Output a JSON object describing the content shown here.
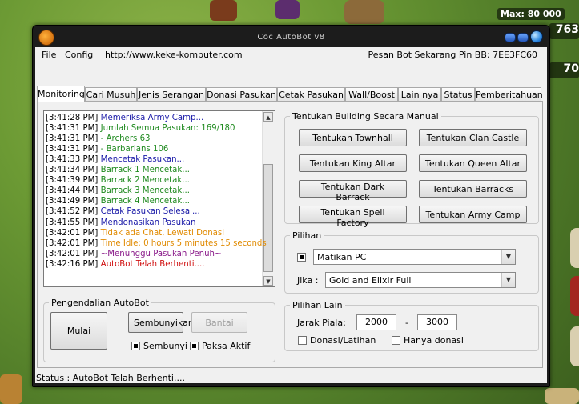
{
  "game_hud": {
    "max_label": "Max: 80 000",
    "value_top": "763",
    "value_side": "70"
  },
  "window": {
    "title": "Coc AutoBot v8",
    "menu": [
      "File",
      "Config",
      "http://www.keke-komputer.com"
    ],
    "pin_text": "Pesan Bot Sekarang Pin BB: 7EE3FC60"
  },
  "tabs": [
    {
      "label": "Monitoring",
      "active": true
    },
    {
      "label": "Cari Musuh"
    },
    {
      "label": "Jenis Serangan"
    },
    {
      "label": "Donasi Pasukan"
    },
    {
      "label": "Cetak Pasukan"
    },
    {
      "label": "Wall/Boost"
    },
    {
      "label": "Lain nya"
    },
    {
      "label": "Status"
    },
    {
      "label": "Pemberitahuan"
    }
  ],
  "log": [
    {
      "time": "[3:41:28 PM]",
      "text": "Memeriksa Army Camp...",
      "color": "#1a1aa8"
    },
    {
      "time": "[3:41:31 PM]",
      "text": "Jumlah Semua Pasukan: 169/180",
      "color": "#1f8a1f"
    },
    {
      "time": "[3:41:31 PM]",
      "text": "- Archers 63",
      "color": "#1f8a1f"
    },
    {
      "time": "[3:41:31 PM]",
      "text": "- Barbarians 106",
      "color": "#1f8a1f"
    },
    {
      "time": "[3:41:33 PM]",
      "text": "Mencetak Pasukan...",
      "color": "#1a1aa8"
    },
    {
      "time": "[3:41:34 PM]",
      "text": "Barrack 1 Mencetak...",
      "color": "#1f8a1f"
    },
    {
      "time": "[3:41:39 PM]",
      "text": "Barrack 2 Mencetak...",
      "color": "#1f8a1f"
    },
    {
      "time": "[3:41:44 PM]",
      "text": "Barrack 3 Mencetak...",
      "color": "#1f8a1f"
    },
    {
      "time": "[3:41:49 PM]",
      "text": "Barrack 4 Mencetak...",
      "color": "#1f8a1f"
    },
    {
      "time": "[3:41:52 PM]",
      "text": "Cetak Pasukan Selesai...",
      "color": "#1a1aa8"
    },
    {
      "time": "[3:41:55 PM]",
      "text": "Mendonasikan Pasukan",
      "color": "#1a1aa8"
    },
    {
      "time": "[3:42:01 PM]",
      "text": "Tidak ada Chat, Lewati Donasi",
      "color": "#e08a00"
    },
    {
      "time": "[3:42:01 PM]",
      "text": "Time Idle: 0 hours 5 minutes 15 seconds",
      "color": "#e08a00"
    },
    {
      "time": "[3:42:01 PM]",
      "text": "~Menunggu Pasukan Penuh~",
      "color": "#8a1a8a"
    },
    {
      "time": "[3:42:16 PM]",
      "text": "AutoBot Telah Berhenti....",
      "color": "#d01010"
    }
  ],
  "building": {
    "legend": "Tentukan Building Secara Manual",
    "buttons": [
      "Tentukan Townhall",
      "Tentukan Clan Castle",
      "Tentukan King Altar",
      "Tentukan Queen Altar",
      "Tentukan Dark Barrack",
      "Tentukan Barracks",
      "Tentukan Spell Factory",
      "Tentukan Army Camp"
    ]
  },
  "pilihan": {
    "legend": "Pilihan",
    "checkbox_checked": true,
    "action_select": "Matikan PC",
    "jika_label": "Jika :",
    "jika_select": "Gold and Elixir Full"
  },
  "pilihan_lain": {
    "legend": "Pilihan Lain",
    "jarak_label": "Jarak Piala:",
    "jarak_min": "2000",
    "dash": "-",
    "jarak_max": "3000",
    "donasi_latihan": "Donasi/Latihan",
    "donasi_latihan_checked": false,
    "hanya_donasi": "Hanya donasi",
    "hanya_donasi_checked": false
  },
  "control": {
    "legend": "Pengendalian AutoBot",
    "start": "Mulai",
    "hide": "Sembunyikan",
    "attack": "Bantai",
    "hidden_label": "Sembunyi",
    "hidden_checked": true,
    "force_label": "Paksa Aktif",
    "force_checked": true
  },
  "status": "Status : AutoBot Telah Berhenti...."
}
